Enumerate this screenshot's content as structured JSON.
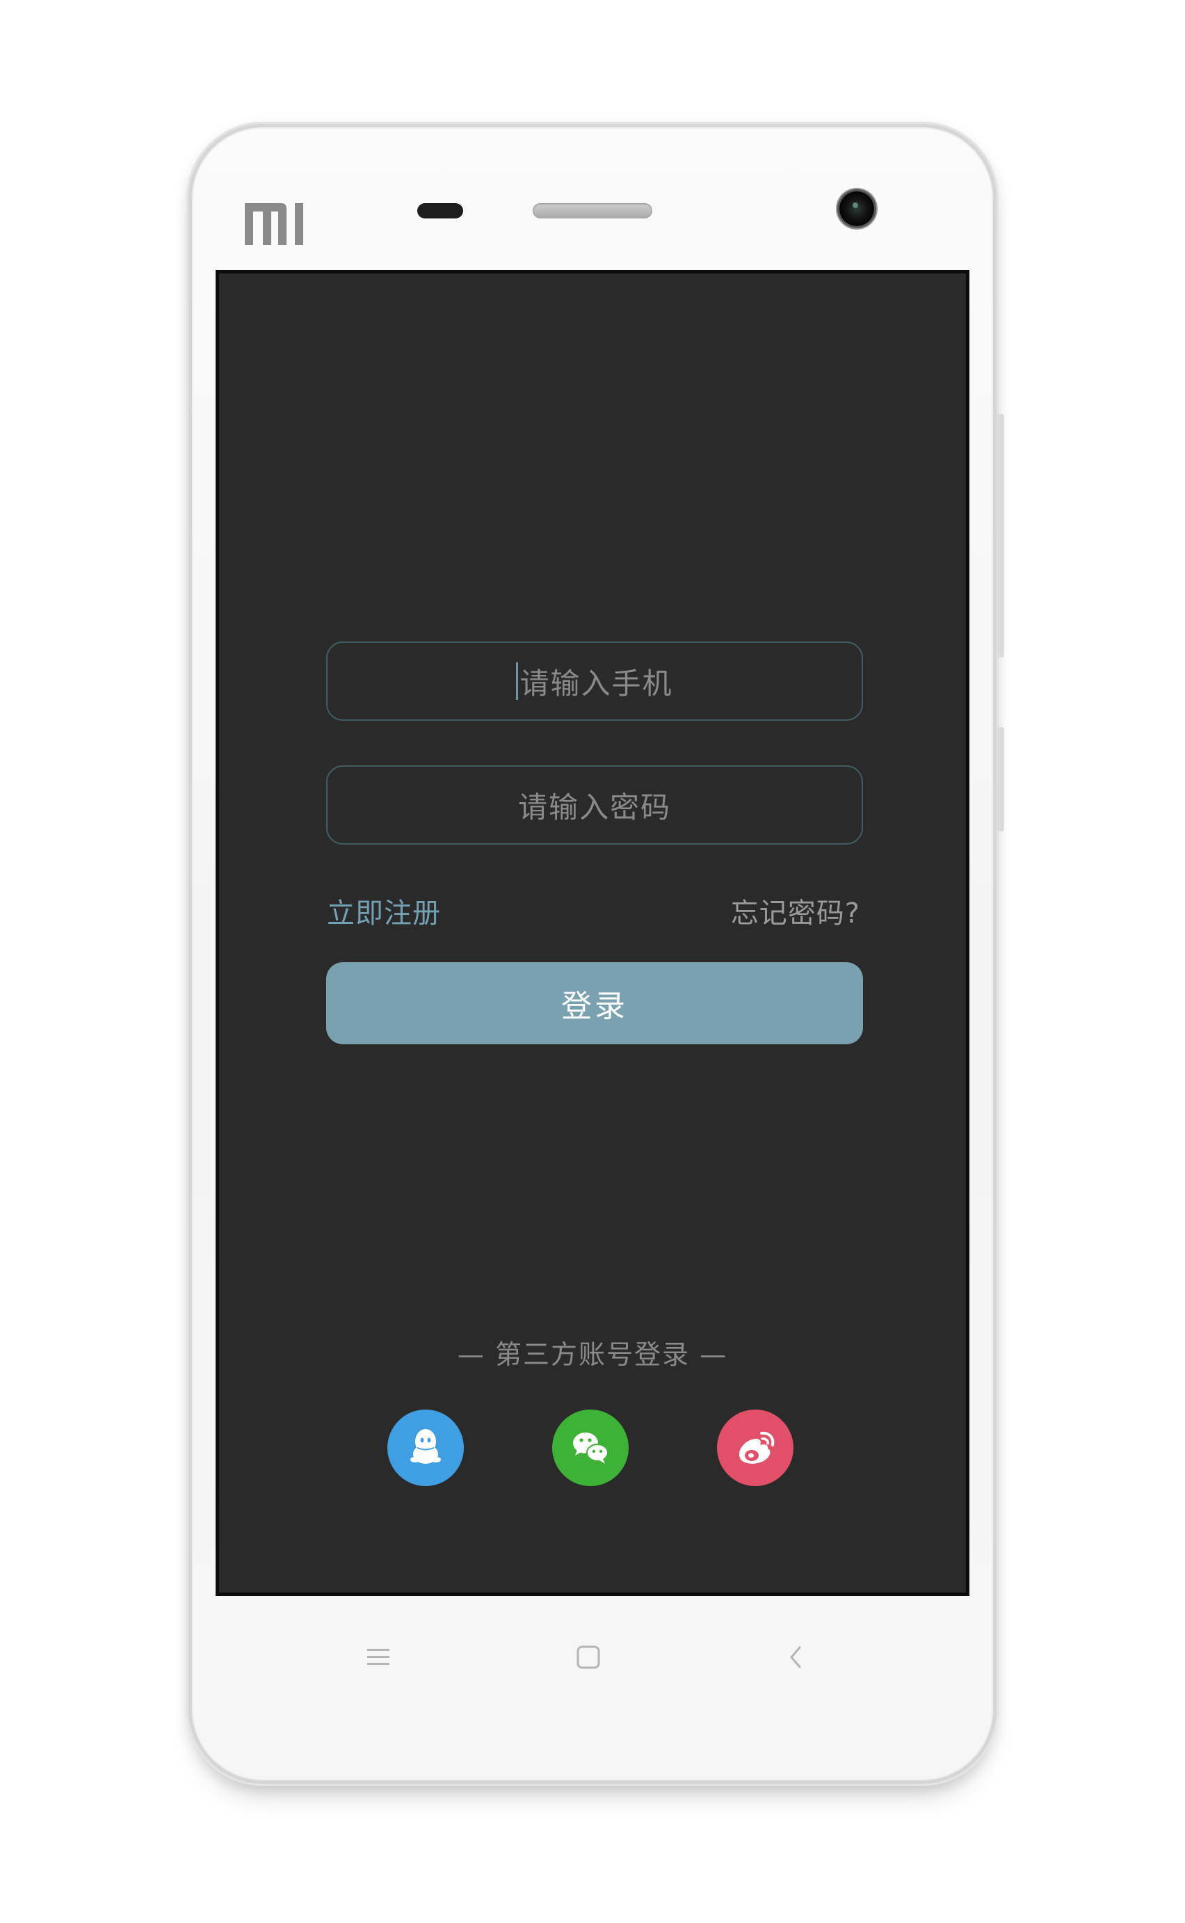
{
  "device": {
    "brand_logo": "MI",
    "colors": {
      "screen_bg": "#2a2a2a",
      "input_border": "#3f5d64",
      "accent": "#7aa1b0",
      "link_accent": "#74a0b3",
      "qq": "#3f9fe2",
      "wechat": "#3db236",
      "weibo": "#e15068"
    }
  },
  "login": {
    "phone_placeholder": "请输入手机",
    "password_placeholder": "请输入密码",
    "register_link": "立即注册",
    "forgot_link": "忘记密码?",
    "login_button": "登录"
  },
  "third_party": {
    "title": "— 第三方账号登录 —",
    "providers": [
      {
        "name": "qq-icon"
      },
      {
        "name": "wechat-icon"
      },
      {
        "name": "weibo-icon"
      }
    ]
  },
  "navbar": {
    "icons": [
      "menu-icon",
      "home-icon",
      "back-icon"
    ]
  }
}
